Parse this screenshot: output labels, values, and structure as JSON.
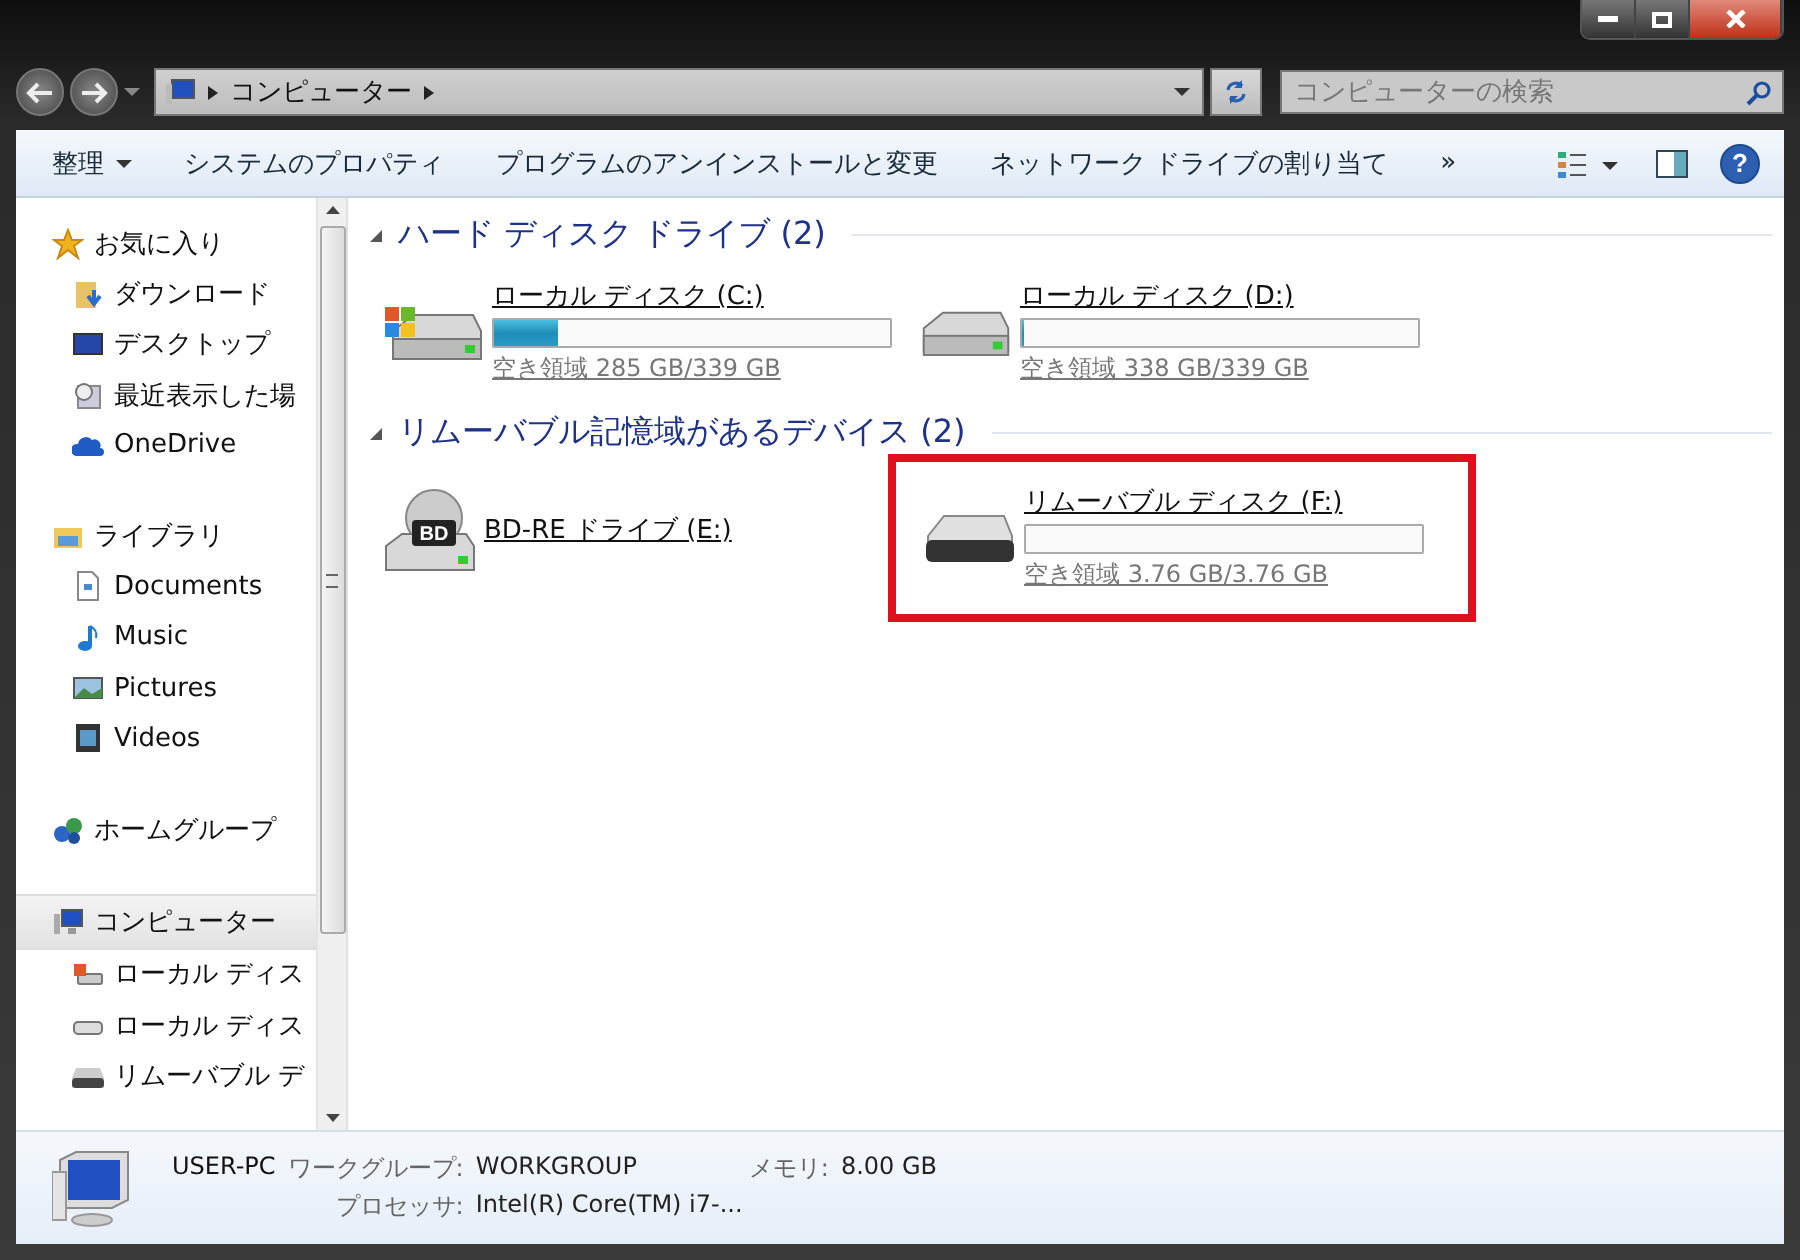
{
  "address_bar": {
    "path": [
      "コンピューター"
    ]
  },
  "search": {
    "placeholder": "コンピューターの検索"
  },
  "toolbar": {
    "items": [
      {
        "label": "整理",
        "dropdown": true
      },
      {
        "label": "システムのプロパティ",
        "dropdown": false
      },
      {
        "label": "プログラムのアンインストールと変更",
        "dropdown": false
      },
      {
        "label": "ネットワーク ドライブの割り当て",
        "dropdown": false
      }
    ],
    "overflow": "»",
    "help": "?"
  },
  "sidebar": {
    "groups": [
      {
        "label": "お気に入り",
        "kind": "star",
        "selected": false,
        "children": [
          {
            "label": "ダウンロード",
            "kind": "download",
            "selected": false
          },
          {
            "label": "デスクトップ",
            "kind": "desktop",
            "selected": false
          },
          {
            "label": "最近表示した場",
            "kind": "recent",
            "selected": false
          },
          {
            "label": "OneDrive",
            "kind": "cloud",
            "selected": false
          }
        ]
      },
      {
        "label": "ライブラリ",
        "kind": "library",
        "selected": false,
        "children": [
          {
            "label": "Documents",
            "kind": "document",
            "selected": false
          },
          {
            "label": "Music",
            "kind": "music",
            "selected": false
          },
          {
            "label": "Pictures",
            "kind": "picture",
            "selected": false
          },
          {
            "label": "Videos",
            "kind": "video",
            "selected": false
          }
        ]
      },
      {
        "label": "ホームグループ",
        "kind": "homegroup",
        "selected": false
      },
      {
        "label": "コンピューター",
        "kind": "computer",
        "selected": true,
        "children": [
          {
            "label": "ローカル ディス",
            "kind": "system-disk",
            "selected": false
          },
          {
            "label": "ローカル ディス",
            "kind": "disk",
            "selected": false
          },
          {
            "label": "リムーバブル デ",
            "kind": "removable",
            "selected": false
          }
        ]
      }
    ]
  },
  "sections": [
    {
      "title": "ハード ディスク ドライブ (2)",
      "expanded": true,
      "devices": [
        {
          "kind": "system-disk",
          "name": "ローカル ディスク (C:)",
          "level": 0.16,
          "free": "空き領域 285 GB/339 GB",
          "highlighted": false
        },
        {
          "kind": "disk",
          "name": "ローカル ディスク (D:)",
          "level": 0.003,
          "free": "空き領域 338 GB/339 GB",
          "highlighted": false
        }
      ]
    },
    {
      "title": "リムーバブル記憶域があるデバイス (2)",
      "expanded": true,
      "devices": [
        {
          "kind": "optical",
          "name": "BD-RE ドライブ (E:)",
          "badge": "BD",
          "highlighted": false
        },
        {
          "kind": "removable",
          "name": "リムーバブル ディスク (F:)",
          "level": 0,
          "free": "空き領域 3.76 GB/3.76 GB",
          "highlighted": true
        }
      ]
    }
  ],
  "status_bar": {
    "name": "USER-PC",
    "fields": [
      {
        "label": "ワークグループ:",
        "value": "WORKGROUP"
      },
      {
        "label": "メモリ:",
        "value": "8.00 GB"
      },
      {
        "label": "プロセッサ:",
        "value": "Intel(R) Core(TM) i7-..."
      }
    ]
  }
}
